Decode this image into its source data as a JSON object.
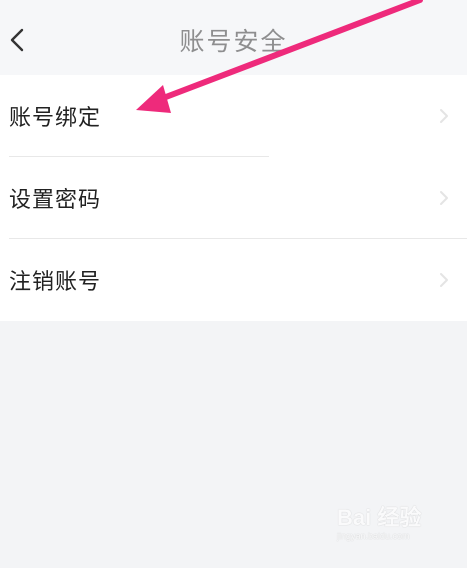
{
  "header": {
    "title": "账号安全",
    "back_icon": "chevron-left-icon"
  },
  "settings": {
    "items": [
      {
        "label": "账号绑定",
        "icon": "chevron-right-icon"
      },
      {
        "label": "设置密码",
        "icon": "chevron-right-icon"
      },
      {
        "label": "注销账号",
        "icon": "chevron-right-icon"
      }
    ]
  },
  "annotation": {
    "arrow_color": "#ee2a7b"
  },
  "watermark": {
    "main": "Bai 经验",
    "sub": "jingyan.baidu.com"
  }
}
